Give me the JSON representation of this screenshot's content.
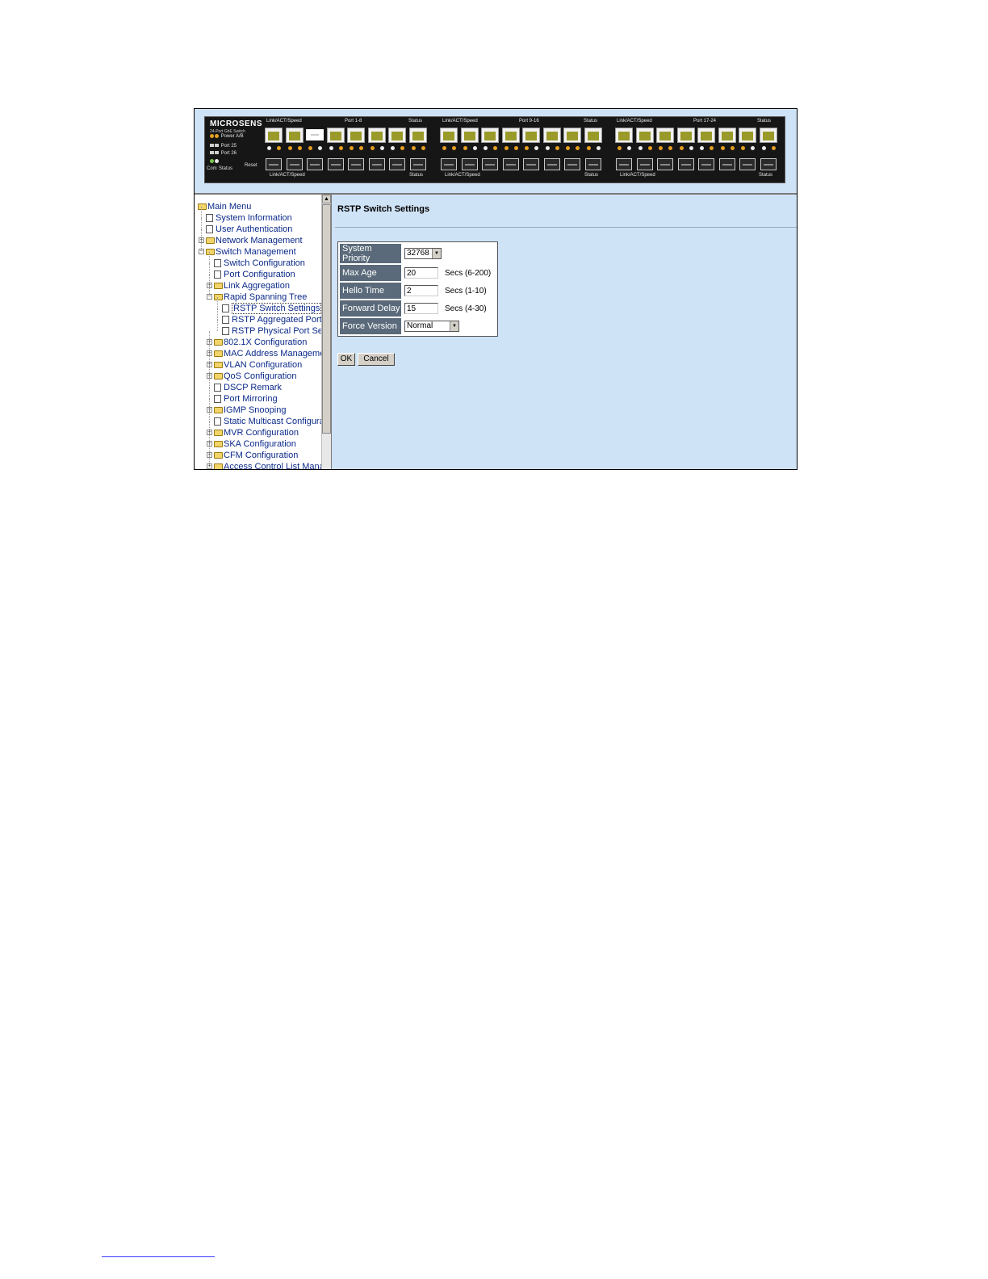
{
  "device": {
    "brand": "MICROSENS",
    "model": "24-Port GbE Switch",
    "led_labels": {
      "power": "Power A/B",
      "port25": "Port 25",
      "port26": "Port 26",
      "com": "Com",
      "status": "Status",
      "reset": "Reset"
    },
    "groups": [
      {
        "top_left": "Link/ACT/Speed",
        "top_mid": "Port 1-8",
        "top_right": "Status",
        "bottom_left": "Link/ACT/Speed",
        "bottom_right": "Status"
      },
      {
        "top_left": "Link/ACT/Speed",
        "top_mid": "Port 9-16",
        "top_right": "Status",
        "bottom_left": "Link/ACT/Speed",
        "bottom_right": "Status"
      },
      {
        "top_left": "Link/ACT/Speed",
        "top_mid": "Port 17-24",
        "top_right": "Status",
        "bottom_left": "Link/ACT/Speed",
        "bottom_right": "Status"
      }
    ]
  },
  "menu": {
    "items": [
      {
        "label": "Main Menu",
        "icon": "folder-open-icon",
        "level": 0
      },
      {
        "label": "System Information",
        "icon": "document-icon",
        "level": 1
      },
      {
        "label": "User Authentication",
        "icon": "document-icon",
        "level": 1
      },
      {
        "label": "Network Management",
        "icon": "folder-icon",
        "level": 1,
        "expander": "+"
      },
      {
        "label": "Switch Management",
        "icon": "folder-open-icon",
        "level": 1,
        "expander": "-"
      },
      {
        "label": "Switch Configuration",
        "icon": "document-icon",
        "level": 2
      },
      {
        "label": "Port Configuration",
        "icon": "document-icon",
        "level": 2
      },
      {
        "label": "Link Aggregation",
        "icon": "folder-icon",
        "level": 2,
        "expander": "+"
      },
      {
        "label": "Rapid Spanning Tree",
        "icon": "folder-open-icon",
        "level": 2,
        "expander": "-"
      },
      {
        "label": "RSTP Switch Settings",
        "icon": "document-icon",
        "level": 3,
        "selected": true
      },
      {
        "label": "RSTP Aggregated Port S",
        "icon": "document-icon",
        "level": 3
      },
      {
        "label": "RSTP Physical Port Setti",
        "icon": "document-icon",
        "level": 3
      },
      {
        "label": "802.1X Configuration",
        "icon": "folder-icon",
        "level": 2,
        "expander": "+"
      },
      {
        "label": "MAC Address Managemen",
        "icon": "folder-icon",
        "level": 2,
        "expander": "+"
      },
      {
        "label": "VLAN Configuration",
        "icon": "folder-icon",
        "level": 2,
        "expander": "+"
      },
      {
        "label": "QoS Configuration",
        "icon": "folder-icon",
        "level": 2,
        "expander": "+"
      },
      {
        "label": "DSCP Remark",
        "icon": "document-icon",
        "level": 2
      },
      {
        "label": "Port Mirroring",
        "icon": "document-icon",
        "level": 2
      },
      {
        "label": "IGMP Snooping",
        "icon": "folder-icon",
        "level": 2,
        "expander": "+"
      },
      {
        "label": "Static Multicast Configuratio",
        "icon": "document-icon",
        "level": 2
      },
      {
        "label": "MVR Configuration",
        "icon": "folder-icon",
        "level": 2,
        "expander": "+"
      },
      {
        "label": "SKA Configuration",
        "icon": "folder-icon",
        "level": 2,
        "expander": "+"
      },
      {
        "label": "CFM Configuration",
        "icon": "folder-icon",
        "level": 2,
        "expander": "+"
      },
      {
        "label": "Access Control List Manage",
        "icon": "folder-icon",
        "level": 2,
        "expander": "+"
      }
    ]
  },
  "page": {
    "title": "RSTP Switch Settings",
    "fields": {
      "system_priority": {
        "label": "System Priority",
        "value": "32768"
      },
      "max_age": {
        "label": "Max Age",
        "value": "20",
        "unit": "Secs (6-200)"
      },
      "hello_time": {
        "label": "Hello Time",
        "value": "2",
        "unit": "Secs (1-10)"
      },
      "forward_delay": {
        "label": "Forward Delay",
        "value": "15",
        "unit": "Secs (4-30)"
      },
      "force_version": {
        "label": "Force Version",
        "value": "Normal"
      }
    },
    "ok_label": "OK",
    "cancel_label": "Cancel"
  },
  "colors": {
    "content_bg": "#cfe3f7",
    "label_cell_bg": "#5a6a7a",
    "link_text": "#0b2a8a"
  }
}
